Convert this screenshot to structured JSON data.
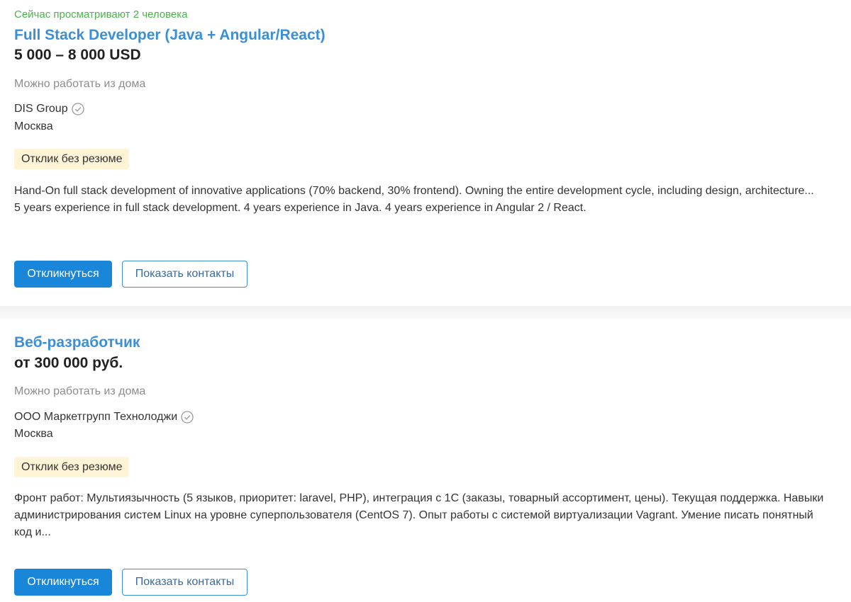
{
  "vacancies": [
    {
      "viewing_now": "Сейчас просматривают 2 человека",
      "title": "Full Stack Developer (Java + Angular/React)",
      "salary": "5 000 – 8 000 USD",
      "remote": "Можно работать из дома",
      "company": "DIS Group",
      "company_verified_icon": "verified-check-icon",
      "city": "Москва",
      "badge": "Отклик без резюме",
      "description": [
        "Hand-On full stack development of innovative applications (70% backend, 30% frontend). Owning the entire development cycle, including design, architecture...",
        "5 years experience in full stack development. 4 years experience in Java. 4 years experience in Angular 2 / React."
      ],
      "respond_label": "Откликнуться",
      "contacts_label": "Показать контакты"
    },
    {
      "title": "Веб-разработчик",
      "salary": "от 300 000 руб.",
      "remote": "Можно работать из дома",
      "company": "ООО Маркетгрупп Технолоджи",
      "company_verified_icon": "verified-check-icon",
      "city": "Москва",
      "badge": "Отклик без резюме",
      "description": [
        "Фронт работ: Мультиязычность (5 языков, приоритет: laravel, PHP), интеграция с 1С (заказы, товарный ассортимент, цены). Текущая поддержка. Навыки администрирования систем Linux на уровне суперпользователя (CentOS 7). Опыт работы с системой виртуализации Vagrant. Умение писать понятный код и..."
      ],
      "respond_label": "Откликнуться",
      "contacts_label": "Показать контакты"
    }
  ],
  "colors": {
    "title": "#3b8fd9",
    "viewing_now": "#4bb34b",
    "primary_button": "#1a86d9",
    "badge_background": "#fff4d6",
    "muted_text": "#8c8c8c"
  }
}
